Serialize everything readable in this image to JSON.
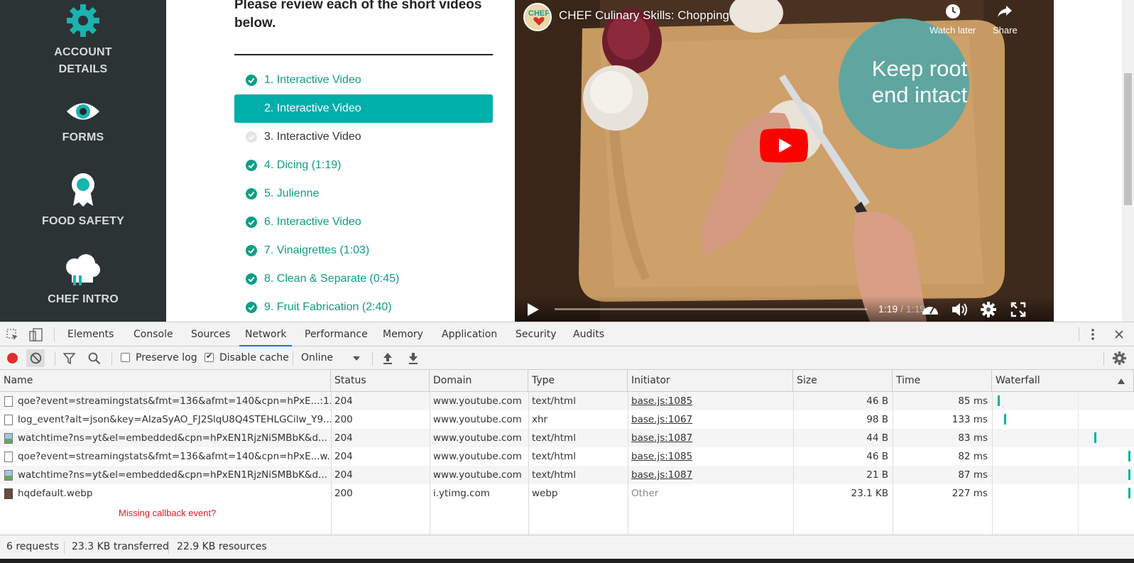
{
  "sidebar": {
    "items": [
      {
        "label1": "ACCOUNT",
        "label2": "DETAILS",
        "icon": "gear-icon"
      },
      {
        "label1": "FORMS",
        "icon": "eye-icon"
      },
      {
        "label1": "FOOD SAFETY",
        "icon": "award-ribbon-icon"
      },
      {
        "label1": "CHEF INTRO",
        "icon": "chef-hat-icon"
      }
    ]
  },
  "content": {
    "instructions": "Please review each of the short videos below.",
    "videos": [
      {
        "label": "1. Interactive Video",
        "state": "completed"
      },
      {
        "label": "2. Interactive Video",
        "state": "active"
      },
      {
        "label": "3. Interactive Video",
        "state": "pending"
      },
      {
        "label": "4. Dicing (1:19)",
        "state": "completed"
      },
      {
        "label": "5. Julienne",
        "state": "completed"
      },
      {
        "label": "6. Interactive Video",
        "state": "completed"
      },
      {
        "label": "7. Vinaigrettes (1:03)",
        "state": "completed"
      },
      {
        "label": "8. Clean & Separate (0:45)",
        "state": "completed"
      },
      {
        "label": "9. Fruit Fabrication (2:40)",
        "state": "completed"
      }
    ]
  },
  "player": {
    "title": "CHEF Culinary Skills: Chopping",
    "channel_logo": "CHEF",
    "watch_later": "Watch later",
    "share": "Share",
    "overlay_line1": "Keep root",
    "overlay_line2": "end intact",
    "current_time": "1:19",
    "time_sep": " / ",
    "duration": "1:19",
    "accent": "#ff0000"
  },
  "devtools": {
    "tabs": [
      "Elements",
      "Console",
      "Sources",
      "Network",
      "Performance",
      "Memory",
      "Application",
      "Security",
      "Audits"
    ],
    "active_tab": "Network",
    "toolbar": {
      "preserve_log": "Preserve log",
      "disable_cache": "Disable cache",
      "throttle": "Online"
    },
    "columns": [
      "Name",
      "Status",
      "Domain",
      "Type",
      "Initiator",
      "Size",
      "Time",
      "Waterfall"
    ],
    "rows": [
      {
        "name": "qoe?event=streamingstats&fmt=136&afmt=140&cpn=hPxE...:1...",
        "status": "204",
        "domain": "www.youtube.com",
        "type": "text/html",
        "initiator": "base.js:1085",
        "size": "46 B",
        "time": "85 ms",
        "icon": "document-icon",
        "wf": 0.02
      },
      {
        "name": "log_event?alt=json&key=AIzaSyAO_FJ2SlqU8Q4STEHLGCilw_Y9...",
        "status": "200",
        "domain": "www.youtube.com",
        "type": "xhr",
        "initiator": "base.js:1067",
        "size": "98 B",
        "time": "133 ms",
        "icon": "document-icon",
        "wf": 0.07
      },
      {
        "name": "watchtime?ns=yt&el=embedded&cpn=hPxEN1RjzNiSMBbK&d...",
        "status": "204",
        "domain": "www.youtube.com",
        "type": "text/html",
        "initiator": "base.js:1087",
        "size": "44 B",
        "time": "83 ms",
        "icon": "image-icon",
        "wf": 0.73
      },
      {
        "name": "qoe?event=streamingstats&fmt=136&afmt=140&cpn=hPxE...w...",
        "status": "204",
        "domain": "www.youtube.com",
        "type": "text/html",
        "initiator": "base.js:1085",
        "size": "46 B",
        "time": "82 ms",
        "icon": "document-icon",
        "wf": 0.98
      },
      {
        "name": "watchtime?ns=yt&el=embedded&cpn=hPxEN1RjzNiSMBbK&d...",
        "status": "204",
        "domain": "www.youtube.com",
        "type": "text/html",
        "initiator": "base.js:1087",
        "size": "21 B",
        "time": "87 ms",
        "icon": "image-icon",
        "wf": 0.98
      },
      {
        "name": "hqdefault.webp",
        "status": "200",
        "domain": "i.ytimg.com",
        "type": "webp",
        "initiator": "Other",
        "size": "23.1 KB",
        "time": "227 ms",
        "icon": "webp-image-icon",
        "wf": 0.98
      }
    ],
    "annotation": "Missing callback event?",
    "status": {
      "requests": "6 requests",
      "transferred": "23.3 KB transferred",
      "resources": "22.9 KB resources"
    }
  }
}
